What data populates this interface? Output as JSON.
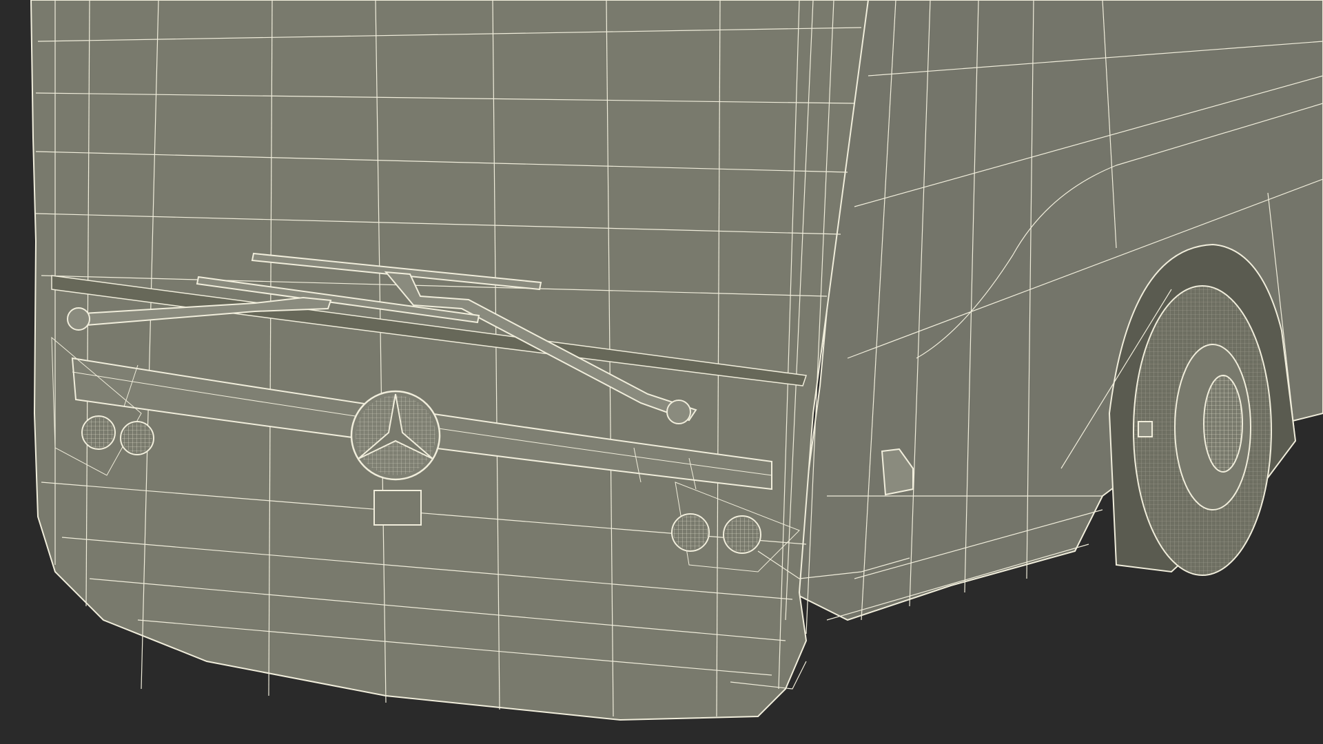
{
  "render": {
    "style": "clay-wireframe",
    "background_color": "#2a2a2a",
    "surface_color": "#797a6d",
    "surface_dark_color": "#676859",
    "wire_color": "#f1eedc",
    "detail_fill_color": "#8a8b7e",
    "tire_color": "#6e6f62"
  },
  "subject": {
    "description_icon": "bus-front-wireframe-icon",
    "emblem_icon": "three-pointed-star-emblem-icon",
    "wheel_icon": "wheel-hub-icon",
    "headlight_icon": "spiderweb-headlight-icon"
  }
}
